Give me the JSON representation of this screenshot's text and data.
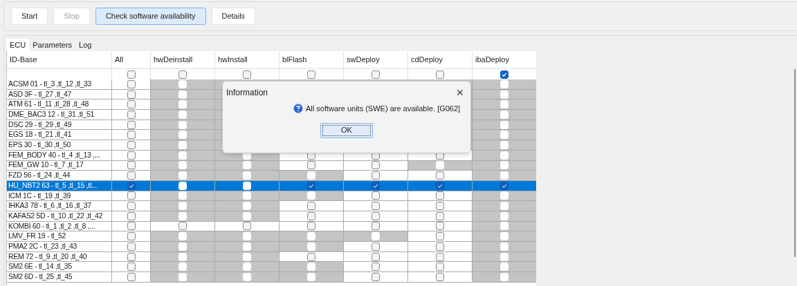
{
  "toolbar": [
    {
      "label": "Start",
      "disabled": false,
      "focused": false
    },
    {
      "label": "Stop",
      "disabled": true,
      "focused": false
    },
    {
      "label": "Check software availability",
      "disabled": false,
      "focused": true
    },
    {
      "label": "Details",
      "disabled": false,
      "focused": false
    }
  ],
  "tabs": [
    {
      "label": "ECU",
      "selected": true
    },
    {
      "label": "Parameters",
      "selected": false
    },
    {
      "label": "Log",
      "selected": false
    }
  ],
  "table": {
    "columns": [
      "ID-Base",
      "All",
      "hwDeinstall",
      "hwInstall",
      "blFlash",
      "swDeploy",
      "cdDeploy",
      "ibaDeploy"
    ],
    "select_all_row": {
      "checked": [
        false,
        false,
        false,
        false,
        false,
        false,
        true
      ]
    },
    "rows": [
      {
        "id": "ACSM 01 - tl_3 ,tl_12 ,tl_33",
        "selected": false,
        "cells": [
          {
            "kind": "checkbox",
            "enabled": true,
            "checked": false
          },
          {
            "kind": "checkbox",
            "enabled": false,
            "checked": false
          },
          {
            "kind": "covered"
          },
          {
            "kind": "covered"
          },
          {
            "kind": "covered"
          },
          {
            "kind": "covered"
          },
          {
            "kind": "checkbox",
            "enabled": false,
            "checked": false
          }
        ]
      },
      {
        "id": "ASD 3F - tl_27 ,tl_47",
        "selected": false,
        "cells": [
          {
            "kind": "checkbox",
            "enabled": true,
            "checked": false
          },
          {
            "kind": "checkbox",
            "enabled": false,
            "checked": false
          },
          {
            "kind": "covered"
          },
          {
            "kind": "covered"
          },
          {
            "kind": "covered"
          },
          {
            "kind": "covered"
          },
          {
            "kind": "checkbox",
            "enabled": false,
            "checked": false
          }
        ]
      },
      {
        "id": "ATM 61 - tl_11 ,tl_28 ,tl_48",
        "selected": false,
        "cells": [
          {
            "kind": "checkbox",
            "enabled": true,
            "checked": false
          },
          {
            "kind": "checkbox",
            "enabled": false,
            "checked": false
          },
          {
            "kind": "covered"
          },
          {
            "kind": "covered"
          },
          {
            "kind": "covered"
          },
          {
            "kind": "covered"
          },
          {
            "kind": "checkbox",
            "enabled": false,
            "checked": false
          }
        ]
      },
      {
        "id": "DME_BAC3 12 - tl_31 ,tl_51",
        "selected": false,
        "cells": [
          {
            "kind": "checkbox",
            "enabled": true,
            "checked": false
          },
          {
            "kind": "checkbox",
            "enabled": false,
            "checked": false
          },
          {
            "kind": "covered"
          },
          {
            "kind": "covered"
          },
          {
            "kind": "covered"
          },
          {
            "kind": "covered"
          },
          {
            "kind": "checkbox",
            "enabled": false,
            "checked": false
          }
        ]
      },
      {
        "id": "DSC 29 - tl_29 ,tl_49",
        "selected": false,
        "cells": [
          {
            "kind": "checkbox",
            "enabled": true,
            "checked": false
          },
          {
            "kind": "checkbox",
            "enabled": false,
            "checked": false
          },
          {
            "kind": "covered"
          },
          {
            "kind": "covered"
          },
          {
            "kind": "covered"
          },
          {
            "kind": "covered"
          },
          {
            "kind": "checkbox",
            "enabled": false,
            "checked": false
          }
        ]
      },
      {
        "id": "EGS 18 - tl_21 ,tl_41",
        "selected": false,
        "cells": [
          {
            "kind": "checkbox",
            "enabled": true,
            "checked": false
          },
          {
            "kind": "checkbox",
            "enabled": false,
            "checked": false
          },
          {
            "kind": "covered"
          },
          {
            "kind": "covered"
          },
          {
            "kind": "covered"
          },
          {
            "kind": "covered"
          },
          {
            "kind": "checkbox",
            "enabled": false,
            "checked": false
          }
        ]
      },
      {
        "id": "EPS 30 - tl_30 ,tl_50",
        "selected": false,
        "cells": [
          {
            "kind": "checkbox",
            "enabled": true,
            "checked": false
          },
          {
            "kind": "checkbox",
            "enabled": false,
            "checked": false
          },
          {
            "kind": "covered"
          },
          {
            "kind": "covered"
          },
          {
            "kind": "covered"
          },
          {
            "kind": "covered"
          },
          {
            "kind": "checkbox",
            "enabled": false,
            "checked": false
          }
        ]
      },
      {
        "id": "FEM_BODY 40 - tl_4 ,tl_13 ,...",
        "selected": false,
        "cells": [
          {
            "kind": "checkbox",
            "enabled": true,
            "checked": false
          },
          {
            "kind": "checkbox",
            "enabled": false,
            "checked": false
          },
          {
            "kind": "checkbox",
            "enabled": false,
            "checked": false
          },
          {
            "kind": "checkbox",
            "enabled": true,
            "checked": false
          },
          {
            "kind": "checkbox",
            "enabled": true,
            "checked": false
          },
          {
            "kind": "checkbox",
            "enabled": true,
            "checked": false
          },
          {
            "kind": "checkbox",
            "enabled": false,
            "checked": false
          }
        ]
      },
      {
        "id": "FEM_GW 10 - tl_7 ,tl_17",
        "selected": false,
        "cells": [
          {
            "kind": "checkbox",
            "enabled": true,
            "checked": false
          },
          {
            "kind": "checkbox",
            "enabled": false,
            "checked": false
          },
          {
            "kind": "checkbox",
            "enabled": false,
            "checked": false
          },
          {
            "kind": "checkbox",
            "enabled": true,
            "checked": false
          },
          {
            "kind": "checkbox",
            "enabled": true,
            "checked": false
          },
          {
            "kind": "checkbox",
            "enabled": false,
            "checked": false
          },
          {
            "kind": "checkbox",
            "enabled": false,
            "checked": false
          }
        ]
      },
      {
        "id": "FZD 56 - tl_24 ,tl_44",
        "selected": false,
        "cells": [
          {
            "kind": "checkbox",
            "enabled": true,
            "checked": false
          },
          {
            "kind": "checkbox",
            "enabled": false,
            "checked": false
          },
          {
            "kind": "checkbox",
            "enabled": false,
            "checked": false
          },
          {
            "kind": "checkbox",
            "enabled": false,
            "checked": false
          },
          {
            "kind": "checkbox",
            "enabled": true,
            "checked": false
          },
          {
            "kind": "checkbox",
            "enabled": true,
            "checked": false
          },
          {
            "kind": "checkbox",
            "enabled": false,
            "checked": false
          }
        ]
      },
      {
        "id": "HU_NBT2 63 - tl_5 ,tl_15 ,tl...",
        "selected": true,
        "cells": [
          {
            "kind": "checkbox",
            "enabled": true,
            "checked": true
          },
          {
            "kind": "checkbox",
            "enabled": false,
            "checked": false
          },
          {
            "kind": "checkbox",
            "enabled": false,
            "checked": false
          },
          {
            "kind": "checkbox",
            "enabled": true,
            "checked": true
          },
          {
            "kind": "checkbox",
            "enabled": true,
            "checked": true
          },
          {
            "kind": "checkbox",
            "enabled": true,
            "checked": true
          },
          {
            "kind": "checkbox",
            "enabled": false,
            "checked": true
          }
        ]
      },
      {
        "id": "ICM 1C - tl_19 ,tl_39",
        "selected": false,
        "cells": [
          {
            "kind": "checkbox",
            "enabled": true,
            "checked": false
          },
          {
            "kind": "checkbox",
            "enabled": false,
            "checked": false
          },
          {
            "kind": "checkbox",
            "enabled": false,
            "checked": false
          },
          {
            "kind": "checkbox",
            "enabled": false,
            "checked": false
          },
          {
            "kind": "checkbox",
            "enabled": true,
            "checked": false
          },
          {
            "kind": "checkbox",
            "enabled": true,
            "checked": false
          },
          {
            "kind": "checkbox",
            "enabled": false,
            "checked": false
          }
        ]
      },
      {
        "id": "IHKA3 78 - tl_6 ,tl_16 ,tl_37",
        "selected": false,
        "cells": [
          {
            "kind": "checkbox",
            "enabled": true,
            "checked": false
          },
          {
            "kind": "checkbox",
            "enabled": false,
            "checked": false
          },
          {
            "kind": "checkbox",
            "enabled": false,
            "checked": false
          },
          {
            "kind": "checkbox",
            "enabled": true,
            "checked": false
          },
          {
            "kind": "checkbox",
            "enabled": true,
            "checked": false
          },
          {
            "kind": "checkbox",
            "enabled": true,
            "checked": false
          },
          {
            "kind": "checkbox",
            "enabled": false,
            "checked": false
          }
        ]
      },
      {
        "id": "KAFAS2 5D - tl_10 ,tl_22 ,tl_42",
        "selected": false,
        "cells": [
          {
            "kind": "checkbox",
            "enabled": true,
            "checked": false
          },
          {
            "kind": "checkbox",
            "enabled": false,
            "checked": false
          },
          {
            "kind": "checkbox",
            "enabled": false,
            "checked": false
          },
          {
            "kind": "checkbox",
            "enabled": true,
            "checked": false
          },
          {
            "kind": "checkbox",
            "enabled": true,
            "checked": false
          },
          {
            "kind": "checkbox",
            "enabled": true,
            "checked": false
          },
          {
            "kind": "checkbox",
            "enabled": false,
            "checked": false
          }
        ]
      },
      {
        "id": "KOMBI 60 - tl_1 ,tl_2 ,tl_8 ,...",
        "selected": false,
        "cells": [
          {
            "kind": "checkbox",
            "enabled": true,
            "checked": false
          },
          {
            "kind": "checkbox",
            "enabled": true,
            "checked": false
          },
          {
            "kind": "checkbox",
            "enabled": true,
            "checked": false
          },
          {
            "kind": "checkbox",
            "enabled": true,
            "checked": false
          },
          {
            "kind": "checkbox",
            "enabled": true,
            "checked": false
          },
          {
            "kind": "checkbox",
            "enabled": true,
            "checked": false
          },
          {
            "kind": "checkbox",
            "enabled": false,
            "checked": false
          }
        ]
      },
      {
        "id": "LMV_FR 19 - tl_52",
        "selected": false,
        "cells": [
          {
            "kind": "checkbox",
            "enabled": true,
            "checked": false
          },
          {
            "kind": "checkbox",
            "enabled": false,
            "checked": false
          },
          {
            "kind": "checkbox",
            "enabled": false,
            "checked": false
          },
          {
            "kind": "checkbox",
            "enabled": false,
            "checked": false
          },
          {
            "kind": "checkbox",
            "enabled": false,
            "checked": false
          },
          {
            "kind": "checkbox",
            "enabled": true,
            "checked": false
          },
          {
            "kind": "checkbox",
            "enabled": false,
            "checked": false
          }
        ]
      },
      {
        "id": "PMA2 2C - tl_23 ,tl_43",
        "selected": false,
        "cells": [
          {
            "kind": "checkbox",
            "enabled": true,
            "checked": false
          },
          {
            "kind": "checkbox",
            "enabled": false,
            "checked": false
          },
          {
            "kind": "checkbox",
            "enabled": false,
            "checked": false
          },
          {
            "kind": "checkbox",
            "enabled": false,
            "checked": false
          },
          {
            "kind": "checkbox",
            "enabled": true,
            "checked": false
          },
          {
            "kind": "checkbox",
            "enabled": true,
            "checked": false
          },
          {
            "kind": "checkbox",
            "enabled": false,
            "checked": false
          }
        ]
      },
      {
        "id": "REM 72 - tl_9 ,tl_20 ,tl_40",
        "selected": false,
        "cells": [
          {
            "kind": "checkbox",
            "enabled": true,
            "checked": false
          },
          {
            "kind": "checkbox",
            "enabled": false,
            "checked": false
          },
          {
            "kind": "checkbox",
            "enabled": false,
            "checked": false
          },
          {
            "kind": "checkbox",
            "enabled": true,
            "checked": false
          },
          {
            "kind": "checkbox",
            "enabled": true,
            "checked": false
          },
          {
            "kind": "checkbox",
            "enabled": true,
            "checked": false
          },
          {
            "kind": "checkbox",
            "enabled": false,
            "checked": false
          }
        ]
      },
      {
        "id": "SM2 6E - tl_14 ,tl_35",
        "selected": false,
        "cells": [
          {
            "kind": "checkbox",
            "enabled": true,
            "checked": false
          },
          {
            "kind": "checkbox",
            "enabled": false,
            "checked": false
          },
          {
            "kind": "checkbox",
            "enabled": false,
            "checked": false
          },
          {
            "kind": "checkbox",
            "enabled": false,
            "checked": false
          },
          {
            "kind": "checkbox",
            "enabled": true,
            "checked": false
          },
          {
            "kind": "checkbox",
            "enabled": true,
            "checked": false
          },
          {
            "kind": "checkbox",
            "enabled": false,
            "checked": false
          }
        ]
      },
      {
        "id": "SM2 6D - tl_25 ,tl_45",
        "selected": false,
        "cells": [
          {
            "kind": "checkbox",
            "enabled": true,
            "checked": false
          },
          {
            "kind": "checkbox",
            "enabled": false,
            "checked": false
          },
          {
            "kind": "checkbox",
            "enabled": false,
            "checked": false
          },
          {
            "kind": "checkbox",
            "enabled": false,
            "checked": false
          },
          {
            "kind": "checkbox",
            "enabled": true,
            "checked": false
          },
          {
            "kind": "checkbox",
            "enabled": true,
            "checked": false
          },
          {
            "kind": "checkbox",
            "enabled": false,
            "checked": false
          }
        ]
      }
    ]
  },
  "dialog": {
    "title": "Information",
    "close": "×",
    "message": "All software units (SWE) are available. [G062]",
    "button": "OK"
  }
}
